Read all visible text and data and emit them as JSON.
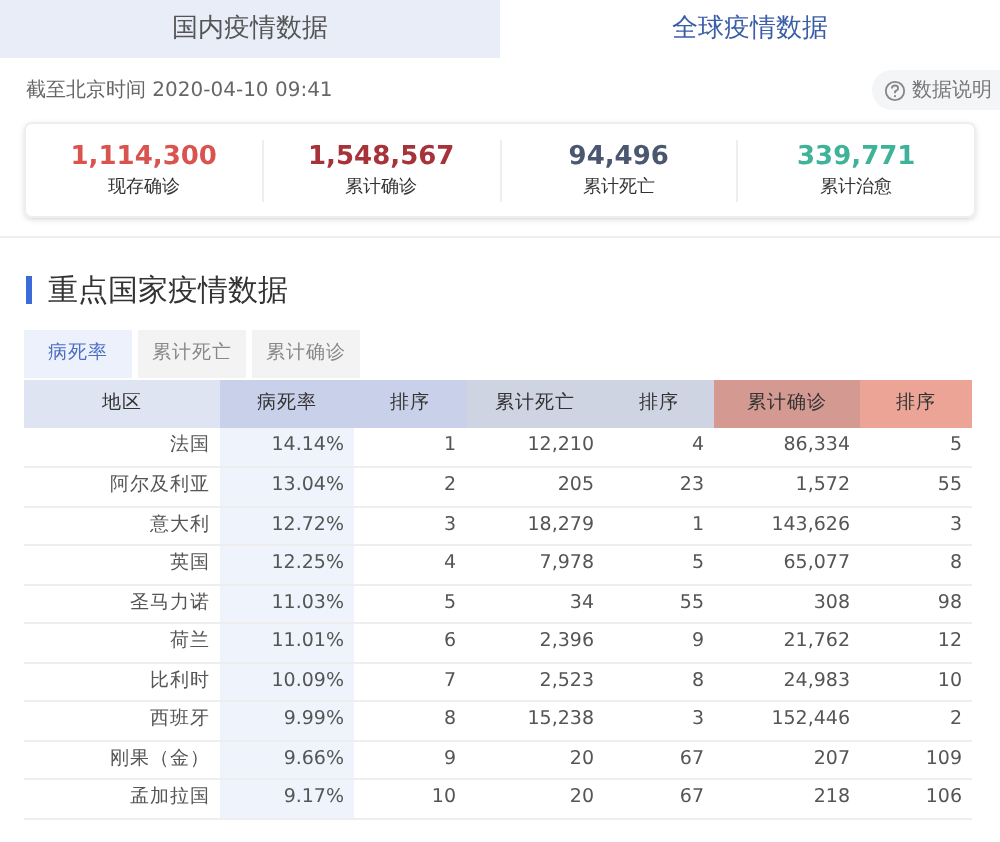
{
  "tabs": [
    {
      "label": "国内疫情数据",
      "selected": false
    },
    {
      "label": "全球疫情数据",
      "selected": true
    }
  ],
  "update_time": "截至北京时间 2020-04-10 09:41",
  "help_link": "数据说明",
  "stats": [
    {
      "value": "1,114,300",
      "label": "现存确诊",
      "color": "#d9534f"
    },
    {
      "value": "1,548,567",
      "label": "累计确诊",
      "color": "#a8323a"
    },
    {
      "value": "94,496",
      "label": "累计死亡",
      "color": "#4b5770"
    },
    {
      "value": "339,771",
      "label": "累计治愈",
      "color": "#3fb39a"
    }
  ],
  "section_title": "重点国家疫情数据",
  "sort_tabs": [
    {
      "label": "病死率",
      "selected": true
    },
    {
      "label": "累计死亡",
      "selected": false
    },
    {
      "label": "累计确诊",
      "selected": false
    }
  ],
  "table": {
    "columns": [
      "地区",
      "病死率",
      "排序",
      "累计死亡",
      "排序",
      "累计确诊",
      "排序"
    ],
    "rows": [
      [
        "法国",
        "14.14%",
        "1",
        "12,210",
        "4",
        "86,334",
        "5"
      ],
      [
        "阿尔及利亚",
        "13.04%",
        "2",
        "205",
        "23",
        "1,572",
        "55"
      ],
      [
        "意大利",
        "12.72%",
        "3",
        "18,279",
        "1",
        "143,626",
        "3"
      ],
      [
        "英国",
        "12.25%",
        "4",
        "7,978",
        "5",
        "65,077",
        "8"
      ],
      [
        "圣马力诺",
        "11.03%",
        "5",
        "34",
        "55",
        "308",
        "98"
      ],
      [
        "荷兰",
        "11.01%",
        "6",
        "2,396",
        "9",
        "21,762",
        "12"
      ],
      [
        "比利时",
        "10.09%",
        "7",
        "2,523",
        "8",
        "24,983",
        "10"
      ],
      [
        "西班牙",
        "9.99%",
        "8",
        "15,238",
        "3",
        "152,446",
        "2"
      ],
      [
        "刚果（金）",
        "9.66%",
        "9",
        "20",
        "67",
        "207",
        "109"
      ],
      [
        "孟加拉国",
        "9.17%",
        "10",
        "20",
        "67",
        "218",
        "106"
      ]
    ]
  }
}
